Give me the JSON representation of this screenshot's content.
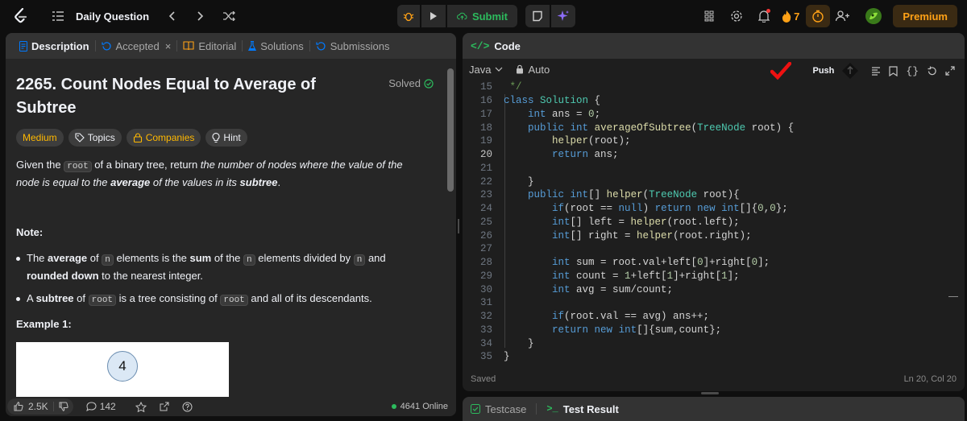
{
  "topbar": {
    "daily_question": "Daily Question",
    "submit_label": "Submit",
    "streak_count": "7",
    "premium_label": "Premium"
  },
  "left_tabs": [
    {
      "label": "Description"
    },
    {
      "label": "Accepted"
    },
    {
      "label": "Editorial"
    },
    {
      "label": "Solutions"
    },
    {
      "label": "Submissions"
    }
  ],
  "problem": {
    "title": "2265. Count Nodes Equal to Average of Subtree",
    "status": "Solved",
    "tags": {
      "difficulty": "Medium",
      "topics": "Topics",
      "companies": "Companies",
      "hint": "Hint"
    },
    "description": {
      "p1": "Given the ",
      "code_root": "root",
      "p2": " of a binary tree, return ",
      "p3_italic": "the number of nodes where the value of the node is equal to the ",
      "p4_bolditalic": "average",
      "p5_italic": " of the values in its ",
      "p6_bolditalic": "subtree",
      "p7": "."
    },
    "note_heading": "Note:",
    "bullet1": {
      "a": "The ",
      "b_bold": "average",
      "c": " of ",
      "d_code": "n",
      "e": " elements is the ",
      "f_bold": "sum",
      "g": " of the ",
      "h_code": "n",
      "i": " elements divided by ",
      "j_code": "n",
      "k": " and ",
      "l_bold": "rounded down",
      "m": " to the nearest integer."
    },
    "bullet2": {
      "a": "A ",
      "b_bold": "subtree",
      "c": " of ",
      "d_code": "root",
      "e": " is a tree consisting of ",
      "f_code": "root",
      "g": " and all of its descendants."
    },
    "example_heading": "Example 1:",
    "tree_root_value": "4"
  },
  "left_footer": {
    "likes": "2.5K",
    "comments": "142",
    "online": "4641 Online"
  },
  "code_panel": {
    "title": "Code",
    "language": "Java",
    "auto_label": "Auto",
    "push_label": "Push",
    "status": "Saved",
    "cursor_pos": "Ln 20, Col 20"
  },
  "bottom_tabs": {
    "testcase": "Testcase",
    "test_result": "Test Result"
  }
}
